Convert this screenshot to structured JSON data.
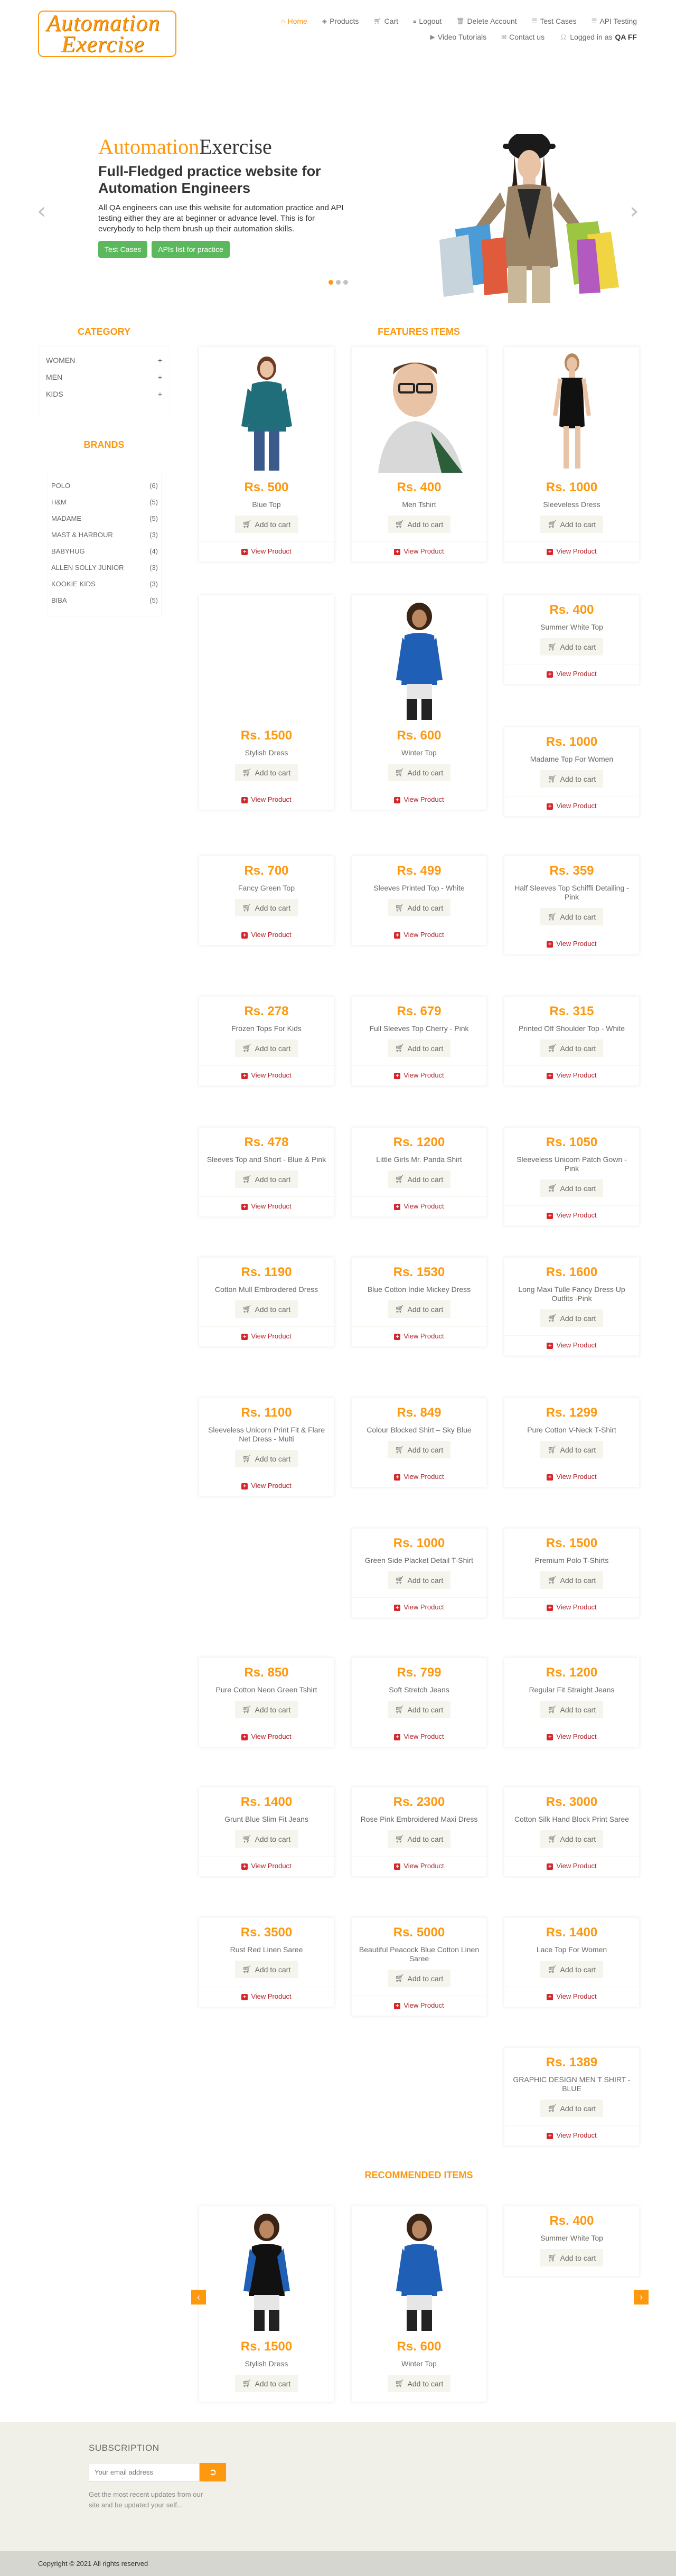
{
  "logo": {
    "line1": "Automation",
    "line2": "Exercise"
  },
  "nav": {
    "home": "Home",
    "products": "Products",
    "cart": "Cart",
    "logout": "Logout",
    "delete_account": "Delete Account",
    "test_cases": "Test Cases",
    "api_testing": "API Testing",
    "video_tutorials": "Video Tutorials",
    "contact_us": "Contact us",
    "logged_in_prefix": "Logged in as",
    "logged_in_user": "QA FF"
  },
  "slider": {
    "brand_a": "Automation",
    "brand_b": "Exercise",
    "heading": "Full-Fledged practice website for Automation Engineers",
    "text": "All QA engineers can use this website for automation practice and API testing either they are at beginner or advance level. This is for everybody to help them brush up their automation skills.",
    "btn_test_cases": "Test Cases",
    "btn_apis": "APIs list for practice",
    "prev": "‹",
    "next": "›"
  },
  "sidebar": {
    "category_title": "Category",
    "categories": [
      {
        "label": "WOMEN",
        "toggle": "+"
      },
      {
        "label": "MEN",
        "toggle": "+"
      },
      {
        "label": "KIDS",
        "toggle": "+"
      }
    ],
    "brands_title": "Brands",
    "brands": [
      {
        "name": "POLO",
        "count": "(6)"
      },
      {
        "name": "H&M",
        "count": "(5)"
      },
      {
        "name": "MADAME",
        "count": "(5)"
      },
      {
        "name": "MAST & HARBOUR",
        "count": "(3)"
      },
      {
        "name": "BABYHUG",
        "count": "(4)"
      },
      {
        "name": "ALLEN SOLLY JUNIOR",
        "count": "(3)"
      },
      {
        "name": "KOOKIE KIDS",
        "count": "(3)"
      },
      {
        "name": "BIBA",
        "count": "(5)"
      }
    ]
  },
  "features_title": "Features Items",
  "add_to_cart": "Add to cart",
  "view_product": "View Product",
  "products": [
    {
      "price": "Rs. 500",
      "name": "Blue Top"
    },
    {
      "price": "Rs. 400",
      "name": "Men Tshirt"
    },
    {
      "price": "Rs. 1000",
      "name": "Sleeveless Dress"
    },
    {
      "price": "Rs. 1500",
      "name": "Stylish Dress"
    },
    {
      "price": "Rs. 600",
      "name": "Winter Top"
    },
    {
      "price": "Rs. 400",
      "name": "Summer White Top"
    },
    {
      "price": "Rs. 1000",
      "name": "Madame Top For Women"
    },
    {
      "price": "Rs. 700",
      "name": "Fancy Green Top"
    },
    {
      "price": "Rs. 499",
      "name": "Sleeves Printed Top - White"
    },
    {
      "price": "Rs. 359",
      "name": "Half Sleeves Top Schiffli Detailing - Pink"
    },
    {
      "price": "Rs. 278",
      "name": "Frozen Tops For Kids"
    },
    {
      "price": "Rs. 679",
      "name": "Full Sleeves Top Cherry - Pink"
    },
    {
      "price": "Rs. 315",
      "name": "Printed Off Shoulder Top - White"
    },
    {
      "price": "Rs. 478",
      "name": "Sleeves Top and Short - Blue & Pink"
    },
    {
      "price": "Rs. 1200",
      "name": "Little Girls Mr. Panda Shirt"
    },
    {
      "price": "Rs. 1050",
      "name": "Sleeveless Unicorn Patch Gown - Pink"
    },
    {
      "price": "Rs. 1190",
      "name": "Cotton Mull Embroidered Dress"
    },
    {
      "price": "Rs. 1530",
      "name": "Blue Cotton Indie Mickey Dress"
    },
    {
      "price": "Rs. 1600",
      "name": "Long Maxi Tulle Fancy Dress Up Outfits -Pink"
    },
    {
      "price": "Rs. 1100",
      "name": "Sleeveless Unicorn Print Fit & Flare Net Dress - Multi"
    },
    {
      "price": "Rs. 849",
      "name": "Colour Blocked Shirt – Sky Blue"
    },
    {
      "price": "Rs. 1299",
      "name": "Pure Cotton V-Neck T-Shirt"
    },
    {
      "price": "Rs. 1000",
      "name": "Green Side Placket Detail T-Shirt"
    },
    {
      "price": "Rs. 1500",
      "name": "Premium Polo T-Shirts"
    },
    {
      "price": "Rs. 850",
      "name": "Pure Cotton Neon Green Tshirt"
    },
    {
      "price": "Rs. 799",
      "name": "Soft Stretch Jeans"
    },
    {
      "price": "Rs. 1200",
      "name": "Regular Fit Straight Jeans"
    },
    {
      "price": "Rs. 1400",
      "name": "Grunt Blue Slim Fit Jeans"
    },
    {
      "price": "Rs. 2300",
      "name": "Rose Pink Embroidered Maxi Dress"
    },
    {
      "price": "Rs. 3000",
      "name": "Cotton Silk Hand Block Print Saree"
    },
    {
      "price": "Rs. 3500",
      "name": "Rust Red Linen Saree"
    },
    {
      "price": "Rs. 5000",
      "name": "Beautiful Peacock Blue Cotton Linen Saree"
    },
    {
      "price": "Rs. 1400",
      "name": "Lace Top For Women"
    },
    {
      "price": "Rs. 1389",
      "name": "GRAPHIC DESIGN MEN T SHIRT - BLUE"
    }
  ],
  "recommended_title": "Recommended Items",
  "recommended": [
    {
      "price": "Rs. 1500",
      "name": "Stylish Dress"
    },
    {
      "price": "Rs. 600",
      "name": "Winter Top"
    },
    {
      "price": "Rs. 400",
      "name": "Summer White Top"
    }
  ],
  "footer": {
    "subscription": "SUBSCRIPTION",
    "email_placeholder": "Your email address",
    "subscribe_text": "Get the most recent updates from our site and be updated your self...",
    "copyright": "Copyright © 2021 All rights reserved"
  },
  "colors": {
    "accent": "#FE980F",
    "green": "#5CB85C",
    "red": "#D4262B"
  }
}
